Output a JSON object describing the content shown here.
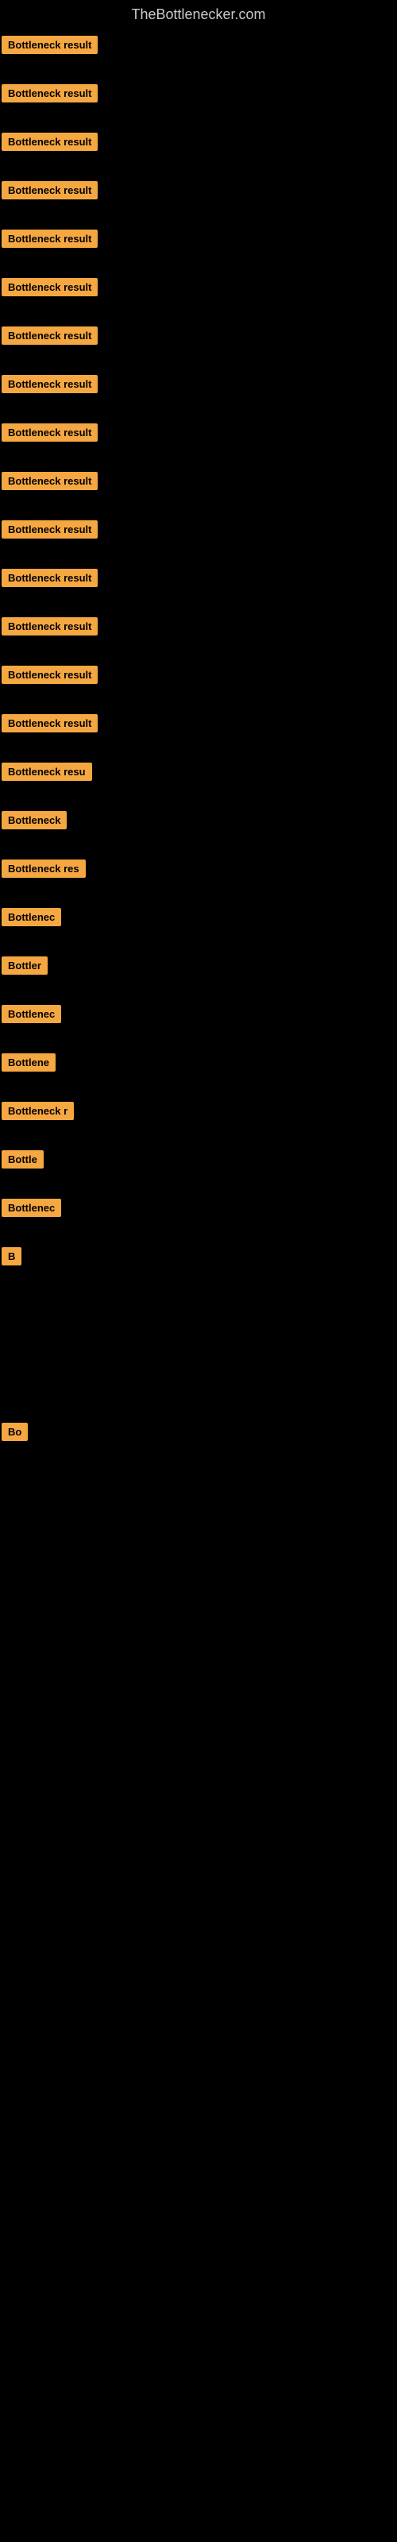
{
  "header": {
    "title": "TheBottlenecker.com"
  },
  "items": [
    {
      "label": "Bottleneck result",
      "width": 130
    },
    {
      "label": "Bottleneck result",
      "width": 130
    },
    {
      "label": "Bottleneck result",
      "width": 130
    },
    {
      "label": "Bottleneck result",
      "width": 130
    },
    {
      "label": "Bottleneck result",
      "width": 130
    },
    {
      "label": "Bottleneck result",
      "width": 130
    },
    {
      "label": "Bottleneck result",
      "width": 130
    },
    {
      "label": "Bottleneck result",
      "width": 130
    },
    {
      "label": "Bottleneck result",
      "width": 130
    },
    {
      "label": "Bottleneck result",
      "width": 130
    },
    {
      "label": "Bottleneck result",
      "width": 130
    },
    {
      "label": "Bottleneck result",
      "width": 130
    },
    {
      "label": "Bottleneck result",
      "width": 130
    },
    {
      "label": "Bottleneck result",
      "width": 130
    },
    {
      "label": "Bottleneck result",
      "width": 130
    },
    {
      "label": "Bottleneck resu",
      "width": 118
    },
    {
      "label": "Bottleneck",
      "width": 82
    },
    {
      "label": "Bottleneck res",
      "width": 105
    },
    {
      "label": "Bottlenec",
      "width": 76
    },
    {
      "label": "Bottler",
      "width": 60
    },
    {
      "label": "Bottlenec",
      "width": 76
    },
    {
      "label": "Bottlene",
      "width": 66
    },
    {
      "label": "Bottleneck r",
      "width": 90
    },
    {
      "label": "Bottle",
      "width": 52
    },
    {
      "label": "Bottlenec",
      "width": 76
    },
    {
      "label": "B",
      "width": 16
    },
    {
      "label": "",
      "width": 8
    },
    {
      "label": "",
      "width": 0
    },
    {
      "label": "",
      "width": 0
    },
    {
      "label": "",
      "width": 0
    },
    {
      "label": "Bo",
      "width": 24
    },
    {
      "label": "",
      "width": 0
    },
    {
      "label": "",
      "width": 0
    },
    {
      "label": "",
      "width": 0
    },
    {
      "label": "",
      "width": 0
    }
  ],
  "colors": {
    "background": "#000000",
    "badge_bg": "#f5a742",
    "badge_text": "#000000",
    "title_text": "#cccccc"
  }
}
